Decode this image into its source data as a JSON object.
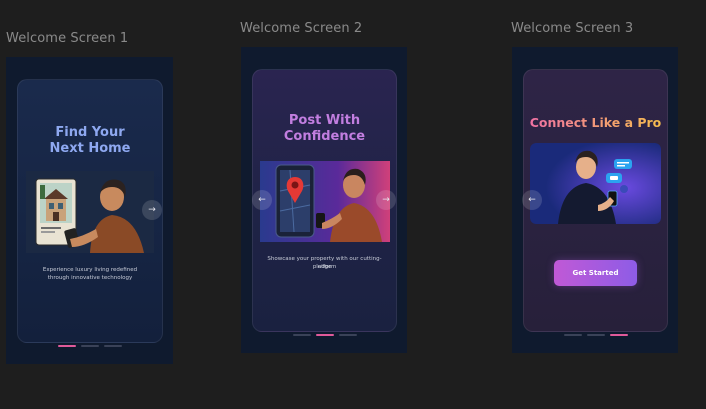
{
  "screens": [
    {
      "frame_label": "Welcome Screen 1",
      "title_line1": "Find Your",
      "title_line2": "Next Home",
      "description_line1": "Experience luxury living redefined",
      "description_line2": "through innovative technology",
      "next_arrow": "→",
      "active_dot": 1
    },
    {
      "frame_label": "Welcome Screen 2",
      "title_line1": "Post With",
      "title_line2": "Confidence",
      "description_line1": "Showcase your property with our cutting-edge",
      "description_line2": "platform",
      "prev_arrow": "←",
      "next_arrow": "→",
      "active_dot": 2
    },
    {
      "frame_label": "Welcome Screen 3",
      "title_line1": "Connect Like a Pro",
      "prev_arrow": "←",
      "cta_label": "Get Started",
      "active_dot": 3
    }
  ],
  "colors": {
    "canvas": "#1e1e1e",
    "frame_bg": "#0f1a2e",
    "title_blue": "#8ea8f0",
    "title_purple": "#c27ee0",
    "title_gradient_start": "#f06fa8",
    "title_gradient_end": "#f5c04a",
    "active_dot": "#e05a9a",
    "cta_start": "#c059d6",
    "cta_end": "#8e5ce6"
  }
}
